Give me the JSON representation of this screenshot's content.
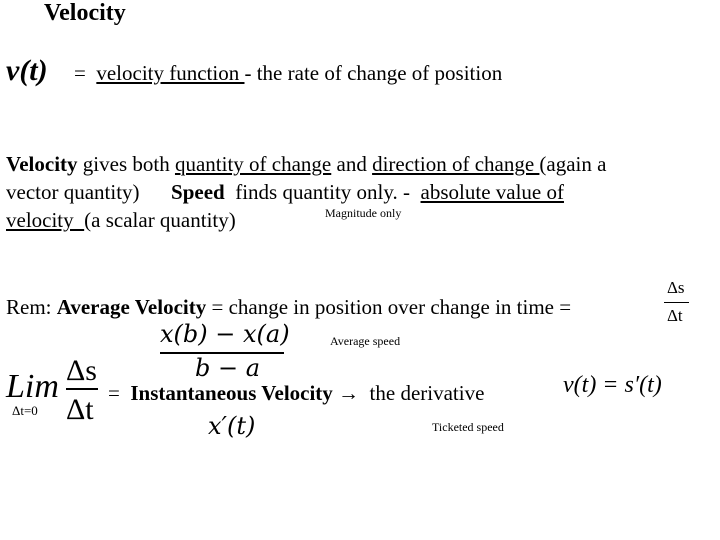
{
  "title": "Velocity",
  "definition": {
    "symbol": "v(t)",
    "equals": "=",
    "term": "velocity function ",
    "rest": " - the rate of change of position"
  },
  "paragraph": {
    "velocity_bold": "Velocity",
    "t1": " gives both ",
    "u1": "quantity of change",
    "t2": " and ",
    "u2": "direction of change ",
    "t3": "(again a",
    "t4": "vector quantity)      ",
    "speed_bold": "Speed",
    "t5": "  finds quantity only. -  ",
    "u3": "absolute value of",
    "u4": "velocity  ",
    "t6": "(a scalar quantity)",
    "annotation": "Magnitude only"
  },
  "rem": {
    "prefix": "Rem: ",
    "bold": "Average Velocity",
    "rest": " = change in position over change in time =",
    "frac_top": "Δs",
    "frac_bottom": "Δt",
    "alt_numerator": "x(b) − x(a)",
    "alt_denominator": "b − a",
    "annotation": "Average speed"
  },
  "limit": {
    "lim": "Lim",
    "sub": "Δt=0",
    "frac_top": "Δs",
    "frac_bottom": "Δt",
    "equals": "= ",
    "bold": "Instantaneous Velocity",
    "arrow": " → ",
    "rest": " the derivative",
    "formula": "v(t) = s′(t)",
    "alt": "x′(t)",
    "annotation": "Ticketed speed"
  }
}
